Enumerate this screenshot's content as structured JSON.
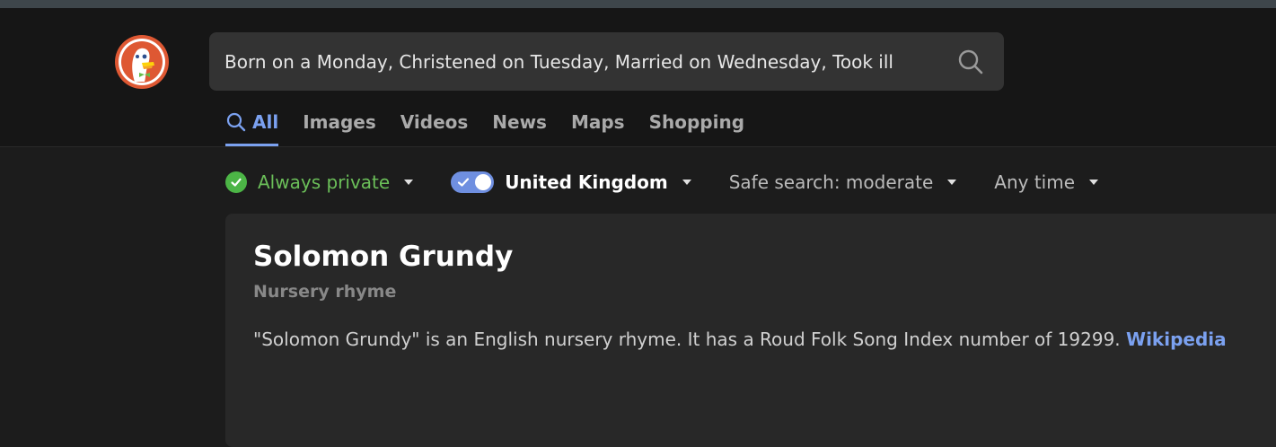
{
  "search": {
    "query": "Born on a Monday, Christened on Tuesday, Married on Wednesday, Took ill",
    "icon": "search-icon"
  },
  "logo": {
    "icon": "duckduckgo-logo-icon"
  },
  "tabs": [
    {
      "label": "All",
      "active": true
    },
    {
      "label": "Images",
      "active": false
    },
    {
      "label": "Videos",
      "active": false
    },
    {
      "label": "News",
      "active": false
    },
    {
      "label": "Maps",
      "active": false
    },
    {
      "label": "Shopping",
      "active": false
    }
  ],
  "filters": {
    "privacy": "Always private",
    "region": "United Kingdom",
    "safe_search": "Safe search: moderate",
    "time": "Any time"
  },
  "result": {
    "title": "Solomon Grundy",
    "subtitle": "Nursery rhyme",
    "abstract": "\"Solomon Grundy\" is an English nursery rhyme. It has a Roud Folk Song Index number of 19299.",
    "source_link": "Wikipedia"
  },
  "colors": {
    "accent": "#7ba1f0",
    "private_green": "#4cb546",
    "background": "#1c1c1c",
    "header": "#161616",
    "card": "#282828"
  }
}
